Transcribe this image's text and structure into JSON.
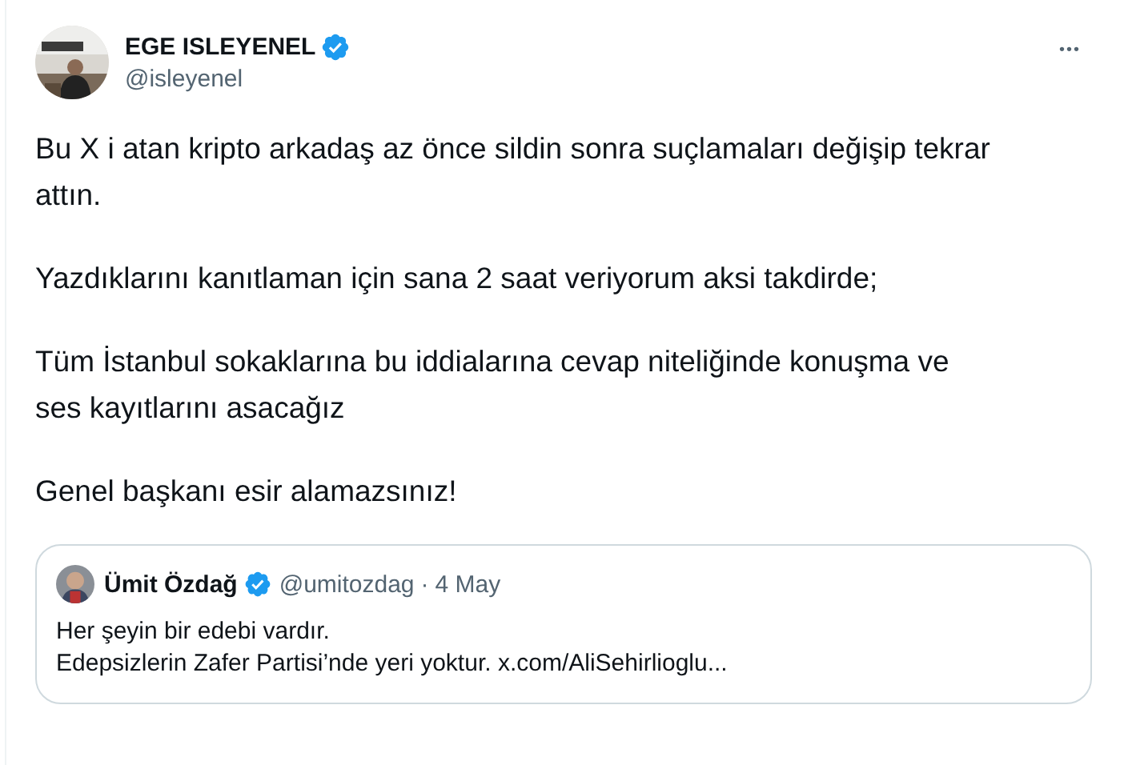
{
  "author": {
    "name": "EGE ISLEYENEL",
    "verified": true,
    "handle": "@isleyenel"
  },
  "more": "•••",
  "paragraphs": [
    {
      "lines": [
        "Bu X i atan kripto arkadaş az önce sildin sonra suçlamaları değişip tekrar",
        "attın."
      ]
    },
    {
      "lines": [
        "Yazdıklarını kanıtlaman için sana 2 saat veriyorum aksi takdirde;"
      ]
    },
    {
      "lines": [
        "Tüm İstanbul sokaklarına bu iddialarına cevap niteliğinde konuşma ve",
        "ses kayıtlarını asacağız"
      ]
    },
    {
      "lines": [
        "Genel başkanı esir alamazsınız!"
      ]
    }
  ],
  "quote": {
    "name": "Ümit Özdağ",
    "verified": true,
    "handle": "@umitozdag",
    "separator": "·",
    "date": "4 May",
    "lines": [
      "Her şeyin bir edebi vardır.",
      "Edepsizlerin Zafer Partisi’nde yeri yoktur."
    ],
    "link": "x.com/AliSehirlioglu..."
  }
}
